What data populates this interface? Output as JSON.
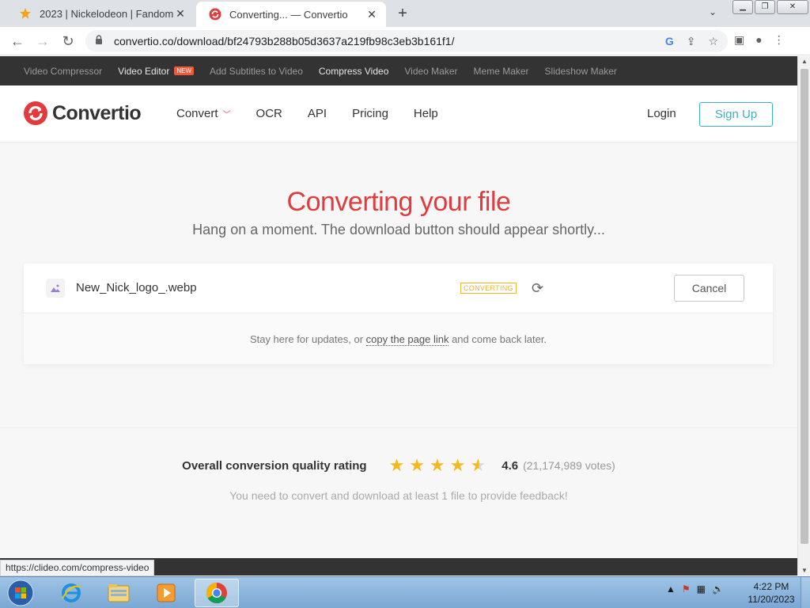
{
  "browser": {
    "tabs": [
      {
        "title": "2023 | Nickelodeon | Fandom",
        "active": false
      },
      {
        "title": "Converting... — Convertio",
        "active": true
      }
    ],
    "url": "convertio.co/download/bf24793b288b05d3637a219fb98c3eb3b161f1/",
    "status_url": "https://clideo.com/compress-video"
  },
  "topnav": {
    "items": [
      {
        "label": "Video Compressor"
      },
      {
        "label": "Video Editor",
        "badge": "NEW"
      },
      {
        "label": "Add Subtitles to Video"
      },
      {
        "label": "Compress Video"
      },
      {
        "label": "Video Maker"
      },
      {
        "label": "Meme Maker"
      },
      {
        "label": "Slideshow Maker"
      }
    ]
  },
  "header": {
    "brand": "Convertio",
    "nav": [
      "Convert",
      "OCR",
      "API",
      "Pricing",
      "Help"
    ],
    "login": "Login",
    "signup": "Sign Up"
  },
  "main": {
    "headline": "Converting your file",
    "subline": "Hang on a moment. The download button should appear shortly...",
    "file": {
      "name": "New_Nick_logo_.webp",
      "status": "CONVERTING",
      "cancel": "Cancel"
    },
    "footer_note_pre": "Stay here for updates, or",
    "footer_note_link": "copy the page link",
    "footer_note_post": "and come back later.",
    "rating": {
      "label": "Overall conversion quality rating",
      "score": "4.6",
      "votes": "(21,174,989 votes)",
      "stars_value": 4.6,
      "stars_max": 5
    },
    "feedback": "You need to convert and download at least 1 file to provide feedback!"
  },
  "taskbar": {
    "time": "4:22 PM",
    "date": "11/20/2023"
  },
  "colors": {
    "brand_red": "#e23b3e",
    "accent_teal": "#3ab0c8",
    "status_amber": "#f0b429",
    "star": "#f5b91e"
  }
}
